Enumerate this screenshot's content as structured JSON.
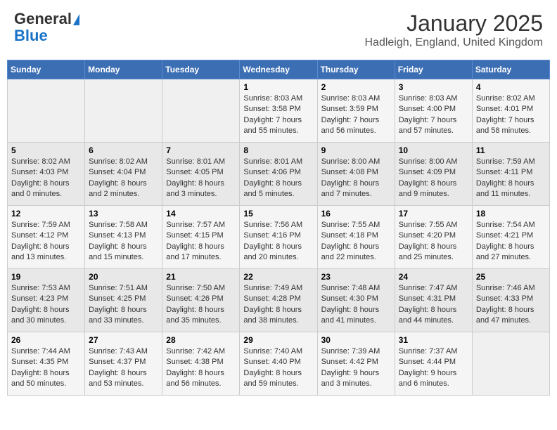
{
  "header": {
    "logo_general": "General",
    "logo_blue": "Blue",
    "title": "January 2025",
    "subtitle": "Hadleigh, England, United Kingdom"
  },
  "days_of_week": [
    "Sunday",
    "Monday",
    "Tuesday",
    "Wednesday",
    "Thursday",
    "Friday",
    "Saturday"
  ],
  "weeks": [
    {
      "cells": [
        {
          "day": null,
          "content": null
        },
        {
          "day": null,
          "content": null
        },
        {
          "day": null,
          "content": null
        },
        {
          "day": "1",
          "content": "Sunrise: 8:03 AM\nSunset: 3:58 PM\nDaylight: 7 hours\nand 55 minutes."
        },
        {
          "day": "2",
          "content": "Sunrise: 8:03 AM\nSunset: 3:59 PM\nDaylight: 7 hours\nand 56 minutes."
        },
        {
          "day": "3",
          "content": "Sunrise: 8:03 AM\nSunset: 4:00 PM\nDaylight: 7 hours\nand 57 minutes."
        },
        {
          "day": "4",
          "content": "Sunrise: 8:02 AM\nSunset: 4:01 PM\nDaylight: 7 hours\nand 58 minutes."
        }
      ]
    },
    {
      "cells": [
        {
          "day": "5",
          "content": "Sunrise: 8:02 AM\nSunset: 4:03 PM\nDaylight: 8 hours\nand 0 minutes."
        },
        {
          "day": "6",
          "content": "Sunrise: 8:02 AM\nSunset: 4:04 PM\nDaylight: 8 hours\nand 2 minutes."
        },
        {
          "day": "7",
          "content": "Sunrise: 8:01 AM\nSunset: 4:05 PM\nDaylight: 8 hours\nand 3 minutes."
        },
        {
          "day": "8",
          "content": "Sunrise: 8:01 AM\nSunset: 4:06 PM\nDaylight: 8 hours\nand 5 minutes."
        },
        {
          "day": "9",
          "content": "Sunrise: 8:00 AM\nSunset: 4:08 PM\nDaylight: 8 hours\nand 7 minutes."
        },
        {
          "day": "10",
          "content": "Sunrise: 8:00 AM\nSunset: 4:09 PM\nDaylight: 8 hours\nand 9 minutes."
        },
        {
          "day": "11",
          "content": "Sunrise: 7:59 AM\nSunset: 4:11 PM\nDaylight: 8 hours\nand 11 minutes."
        }
      ]
    },
    {
      "cells": [
        {
          "day": "12",
          "content": "Sunrise: 7:59 AM\nSunset: 4:12 PM\nDaylight: 8 hours\nand 13 minutes."
        },
        {
          "day": "13",
          "content": "Sunrise: 7:58 AM\nSunset: 4:13 PM\nDaylight: 8 hours\nand 15 minutes."
        },
        {
          "day": "14",
          "content": "Sunrise: 7:57 AM\nSunset: 4:15 PM\nDaylight: 8 hours\nand 17 minutes."
        },
        {
          "day": "15",
          "content": "Sunrise: 7:56 AM\nSunset: 4:16 PM\nDaylight: 8 hours\nand 20 minutes."
        },
        {
          "day": "16",
          "content": "Sunrise: 7:55 AM\nSunset: 4:18 PM\nDaylight: 8 hours\nand 22 minutes."
        },
        {
          "day": "17",
          "content": "Sunrise: 7:55 AM\nSunset: 4:20 PM\nDaylight: 8 hours\nand 25 minutes."
        },
        {
          "day": "18",
          "content": "Sunrise: 7:54 AM\nSunset: 4:21 PM\nDaylight: 8 hours\nand 27 minutes."
        }
      ]
    },
    {
      "cells": [
        {
          "day": "19",
          "content": "Sunrise: 7:53 AM\nSunset: 4:23 PM\nDaylight: 8 hours\nand 30 minutes."
        },
        {
          "day": "20",
          "content": "Sunrise: 7:51 AM\nSunset: 4:25 PM\nDaylight: 8 hours\nand 33 minutes."
        },
        {
          "day": "21",
          "content": "Sunrise: 7:50 AM\nSunset: 4:26 PM\nDaylight: 8 hours\nand 35 minutes."
        },
        {
          "day": "22",
          "content": "Sunrise: 7:49 AM\nSunset: 4:28 PM\nDaylight: 8 hours\nand 38 minutes."
        },
        {
          "day": "23",
          "content": "Sunrise: 7:48 AM\nSunset: 4:30 PM\nDaylight: 8 hours\nand 41 minutes."
        },
        {
          "day": "24",
          "content": "Sunrise: 7:47 AM\nSunset: 4:31 PM\nDaylight: 8 hours\nand 44 minutes."
        },
        {
          "day": "25",
          "content": "Sunrise: 7:46 AM\nSunset: 4:33 PM\nDaylight: 8 hours\nand 47 minutes."
        }
      ]
    },
    {
      "cells": [
        {
          "day": "26",
          "content": "Sunrise: 7:44 AM\nSunset: 4:35 PM\nDaylight: 8 hours\nand 50 minutes."
        },
        {
          "day": "27",
          "content": "Sunrise: 7:43 AM\nSunset: 4:37 PM\nDaylight: 8 hours\nand 53 minutes."
        },
        {
          "day": "28",
          "content": "Sunrise: 7:42 AM\nSunset: 4:38 PM\nDaylight: 8 hours\nand 56 minutes."
        },
        {
          "day": "29",
          "content": "Sunrise: 7:40 AM\nSunset: 4:40 PM\nDaylight: 8 hours\nand 59 minutes."
        },
        {
          "day": "30",
          "content": "Sunrise: 7:39 AM\nSunset: 4:42 PM\nDaylight: 9 hours\nand 3 minutes."
        },
        {
          "day": "31",
          "content": "Sunrise: 7:37 AM\nSunset: 4:44 PM\nDaylight: 9 hours\nand 6 minutes."
        },
        {
          "day": null,
          "content": null
        }
      ]
    }
  ]
}
